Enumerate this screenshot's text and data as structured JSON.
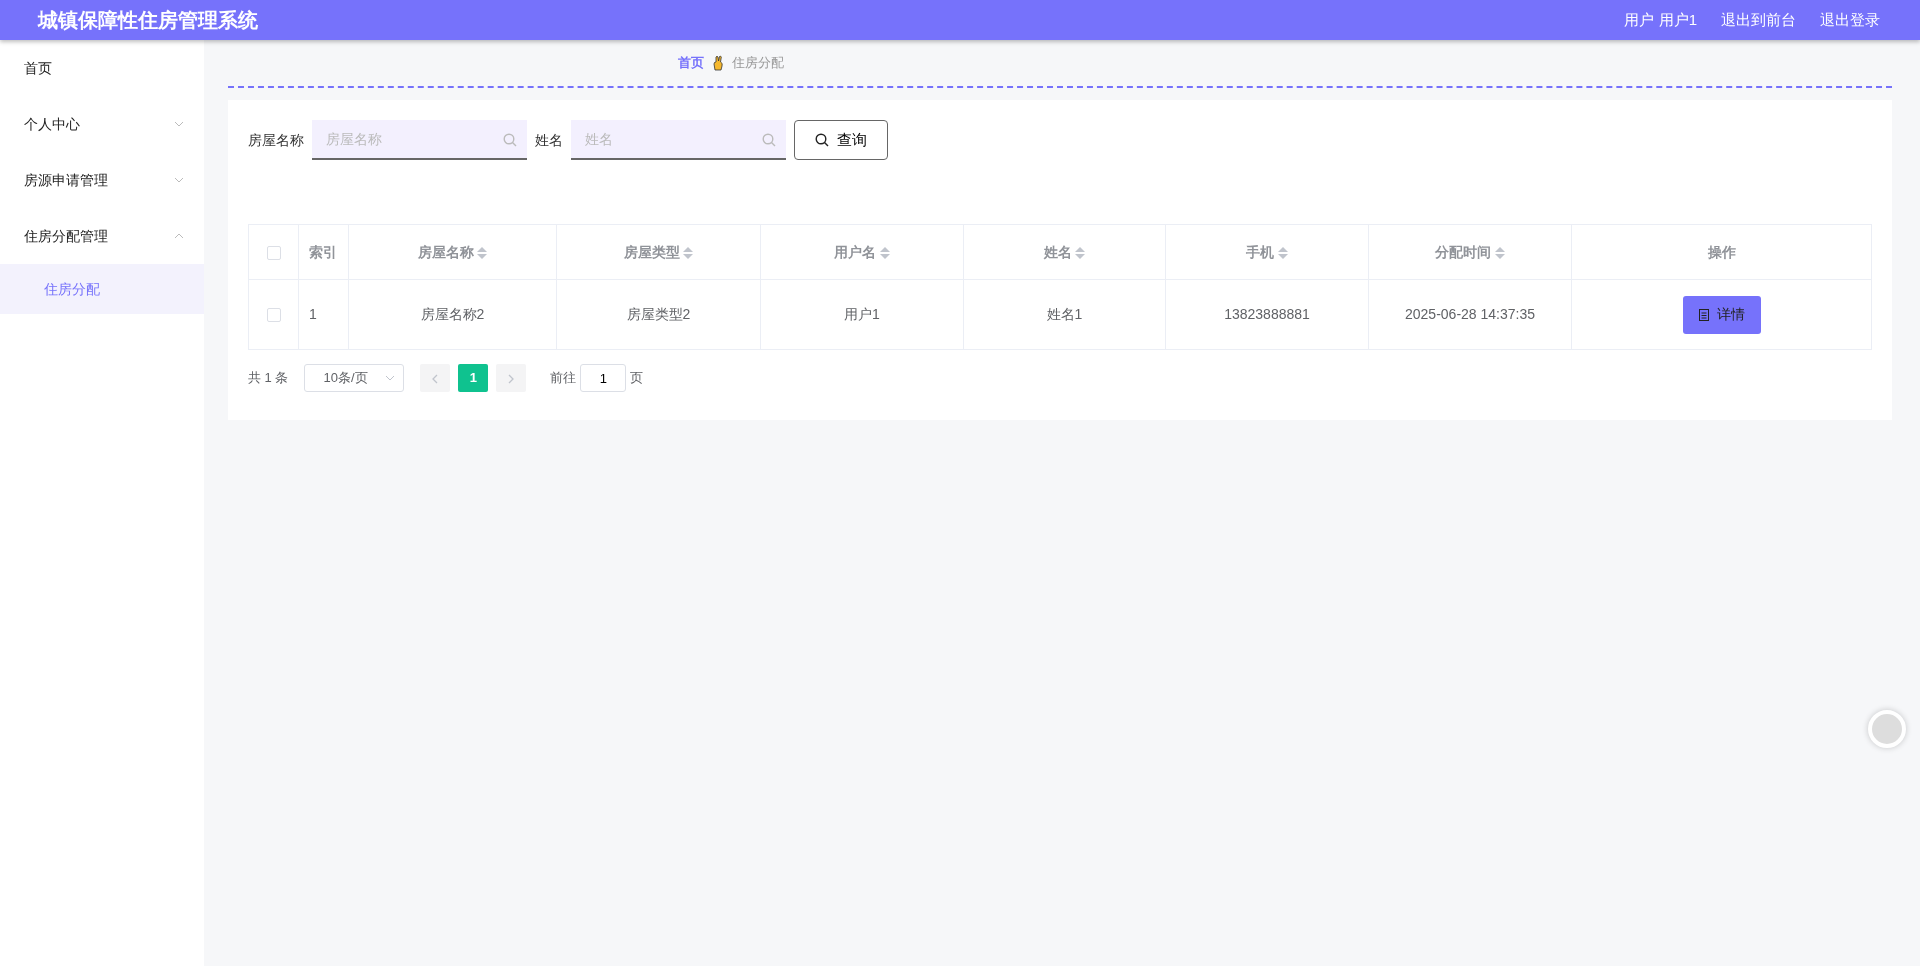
{
  "header": {
    "title": "城镇保障性住房管理系统",
    "links": [
      {
        "label": "用户 用户1"
      },
      {
        "label": "退出到前台"
      },
      {
        "label": "退出登录"
      }
    ]
  },
  "sidebar": {
    "items": [
      {
        "label": "首页",
        "kind": "link"
      },
      {
        "label": "个人中心",
        "kind": "group",
        "expanded": false
      },
      {
        "label": "房源申请管理",
        "kind": "group",
        "expanded": false
      },
      {
        "label": "住房分配管理",
        "kind": "group",
        "expanded": true,
        "children": [
          {
            "label": "住房分配",
            "selected": true
          }
        ]
      }
    ]
  },
  "breadcrumb": [
    {
      "label": "首页",
      "kind": "link"
    },
    {
      "label": "住房分配",
      "kind": "current"
    }
  ],
  "search": {
    "fields": [
      {
        "label": "房屋名称",
        "placeholder": "房屋名称"
      },
      {
        "label": "姓名",
        "placeholder": "姓名"
      }
    ],
    "button": "查询"
  },
  "table": {
    "select_all": {
      "checked": false
    },
    "columns": [
      {
        "label": "索引",
        "sortable": false
      },
      {
        "label": "房屋名称",
        "sortable": true
      },
      {
        "label": "房屋类型",
        "sortable": true
      },
      {
        "label": "用户名",
        "sortable": true
      },
      {
        "label": "姓名",
        "sortable": true
      },
      {
        "label": "手机",
        "sortable": true
      },
      {
        "label": "分配时间",
        "sortable": true
      },
      {
        "label": "操作",
        "sortable": false
      }
    ],
    "rows": [
      {
        "checked": false,
        "cells": [
          "1",
          "房屋名称2",
          "房屋类型2",
          "用户1",
          "姓名1",
          "13823888881",
          "2025-06-28 14:37:35"
        ],
        "action": "详情"
      }
    ]
  },
  "pagination": {
    "total": "共 1 条",
    "page_size": "10条/页",
    "prev_disabled": true,
    "next_disabled": true,
    "pages": [
      {
        "label": "1",
        "selected": true
      }
    ],
    "goto_label": "前往",
    "goto_value": "1",
    "goto_suffix": "页"
  }
}
